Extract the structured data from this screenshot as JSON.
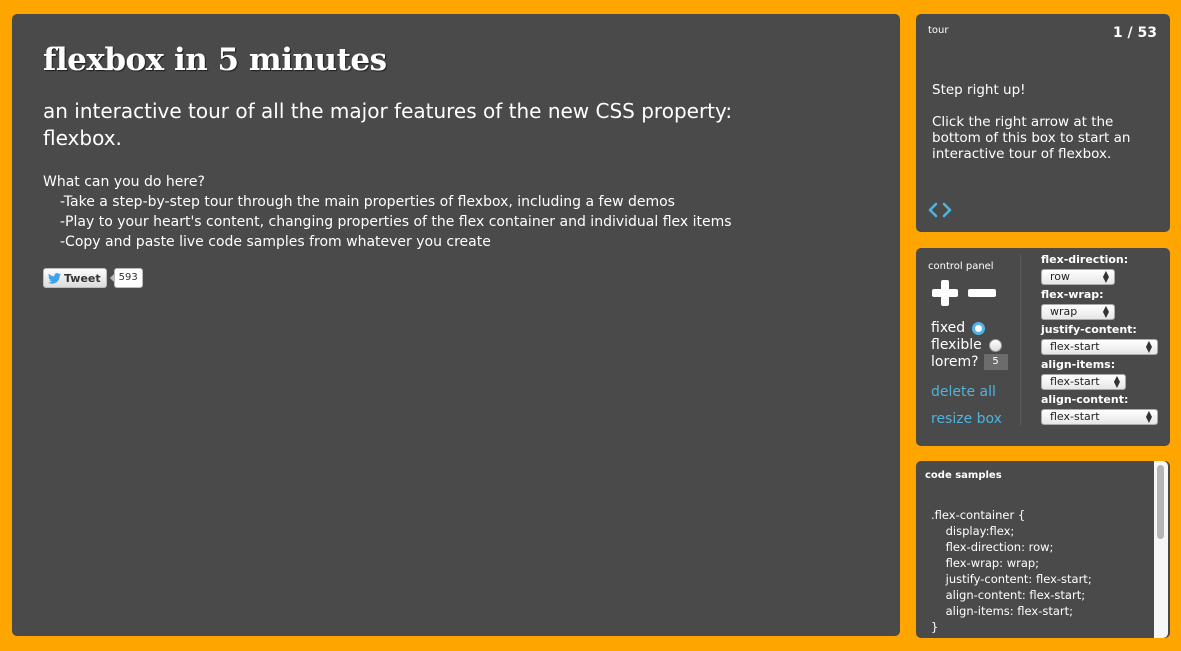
{
  "main": {
    "title": "flexbox in 5 minutes",
    "subtitle": "an interactive tour of all the major features of the new CSS property: flexbox.",
    "intro_heading": "What can you do here?",
    "intro_items": [
      "-Take a step-by-step tour through the main properties of flexbox, including a few demos",
      "-Play to your heart's content, changing properties of the flex container and individual flex items",
      "-Copy and paste live code samples from whatever you create"
    ],
    "tweet": {
      "label": "Tweet",
      "count": "593"
    }
  },
  "tour": {
    "label": "tour",
    "counter": "1 / 53",
    "step_title": "Step right up!",
    "step_body": "Click the right arrow at the bottom of this box to start an interactive tour of flexbox.",
    "prev_icon": "chevron-left-icon",
    "next_icon": "chevron-right-icon"
  },
  "control": {
    "label": "control panel",
    "add_icon": "plus-icon",
    "remove_icon": "minus-icon",
    "fixed_label": "fixed",
    "fixed_checked": true,
    "flexible_label": "flexible",
    "flexible_checked": false,
    "lorem_label": "lorem?",
    "lorem_value": "5",
    "delete_all": "delete all",
    "resize_box": "resize box",
    "props": {
      "flex_direction": {
        "label": "flex-direction:",
        "value": "row"
      },
      "flex_wrap": {
        "label": "flex-wrap:",
        "value": "wrap"
      },
      "justify_content": {
        "label": "justify-content:",
        "value": "flex-start"
      },
      "align_items": {
        "label": "align-items:",
        "value": "flex-start"
      },
      "align_content": {
        "label": "align-content:",
        "value": "flex-start"
      }
    }
  },
  "code": {
    "label": "code samples",
    "sample": ".flex-container {\n    display:flex;\n    flex-direction: row;\n    flex-wrap: wrap;\n    justify-content: flex-start;\n    align-content: flex-start;\n    align-items: flex-start;\n}"
  },
  "colors": {
    "background": "#ffa500",
    "panel": "#4a4a4a",
    "accent": "#4fb3de"
  }
}
